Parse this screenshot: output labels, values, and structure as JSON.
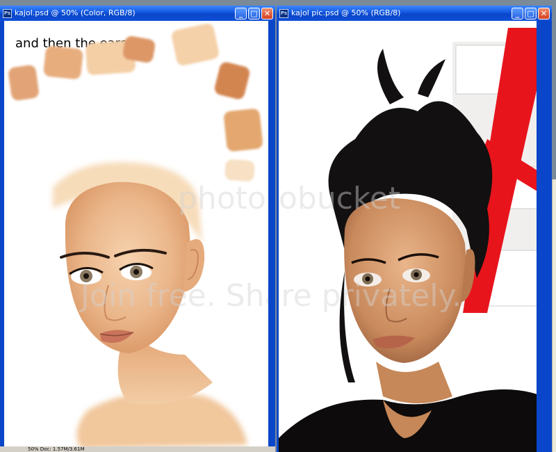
{
  "left_window": {
    "title": "kajol.psd @ 50% (Color, RGB/8)",
    "caption": "and then the ears...",
    "app_icon": "Ps",
    "status": "50%  Doc: 1.57M/3.61M",
    "swatch_colors": [
      "#f2cfa4",
      "#e9b98a",
      "#d99062",
      "#c98552",
      "#f0c99a",
      "#dca06d",
      "#e6a672",
      "#f5d7b0"
    ]
  },
  "right_window": {
    "title": "kajol pic.psd @ 50% (RGB/8)",
    "app_icon": "Ps"
  },
  "buttons": {
    "minimize": "_",
    "maximize": "□",
    "close": "✕"
  },
  "watermark": {
    "logo": "photobucket",
    "slogan": "Join free. Share privately."
  },
  "colors": {
    "titlebar": "#0a46c9",
    "canvas": "#ffffff",
    "accent_red": "#e8141c",
    "hair": "#121010",
    "skin": "#e8b48a"
  }
}
